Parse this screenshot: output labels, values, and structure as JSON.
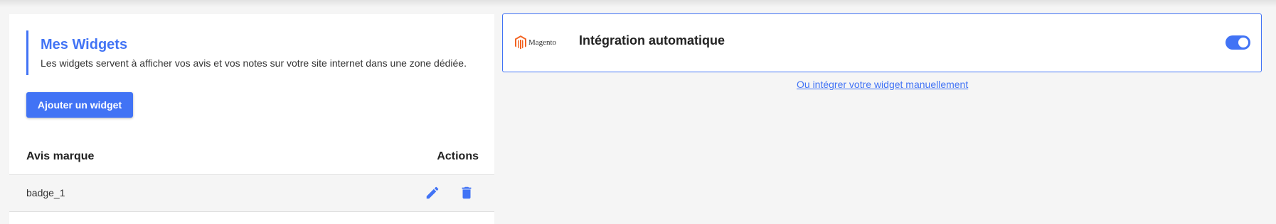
{
  "widgets": {
    "title": "Mes Widgets",
    "description": "Les widgets servent à afficher vos avis et vos notes sur votre site internet dans une zone dédiée.",
    "add_button": "Ajouter un widget",
    "table": {
      "headers": {
        "name": "Avis marque",
        "actions": "Actions"
      },
      "rows": [
        {
          "name": "badge_1"
        }
      ]
    }
  },
  "integration": {
    "platform_logo_text": "Magento",
    "title": "Intégration automatique",
    "toggle_on": true,
    "manual_link": "Ou intégrer votre widget manuellement"
  },
  "icons": {
    "edit": "pencil-icon",
    "delete": "trash-icon",
    "platform": "magento-logo"
  },
  "colors": {
    "accent": "#4173f5",
    "magento_orange": "#f26322"
  }
}
